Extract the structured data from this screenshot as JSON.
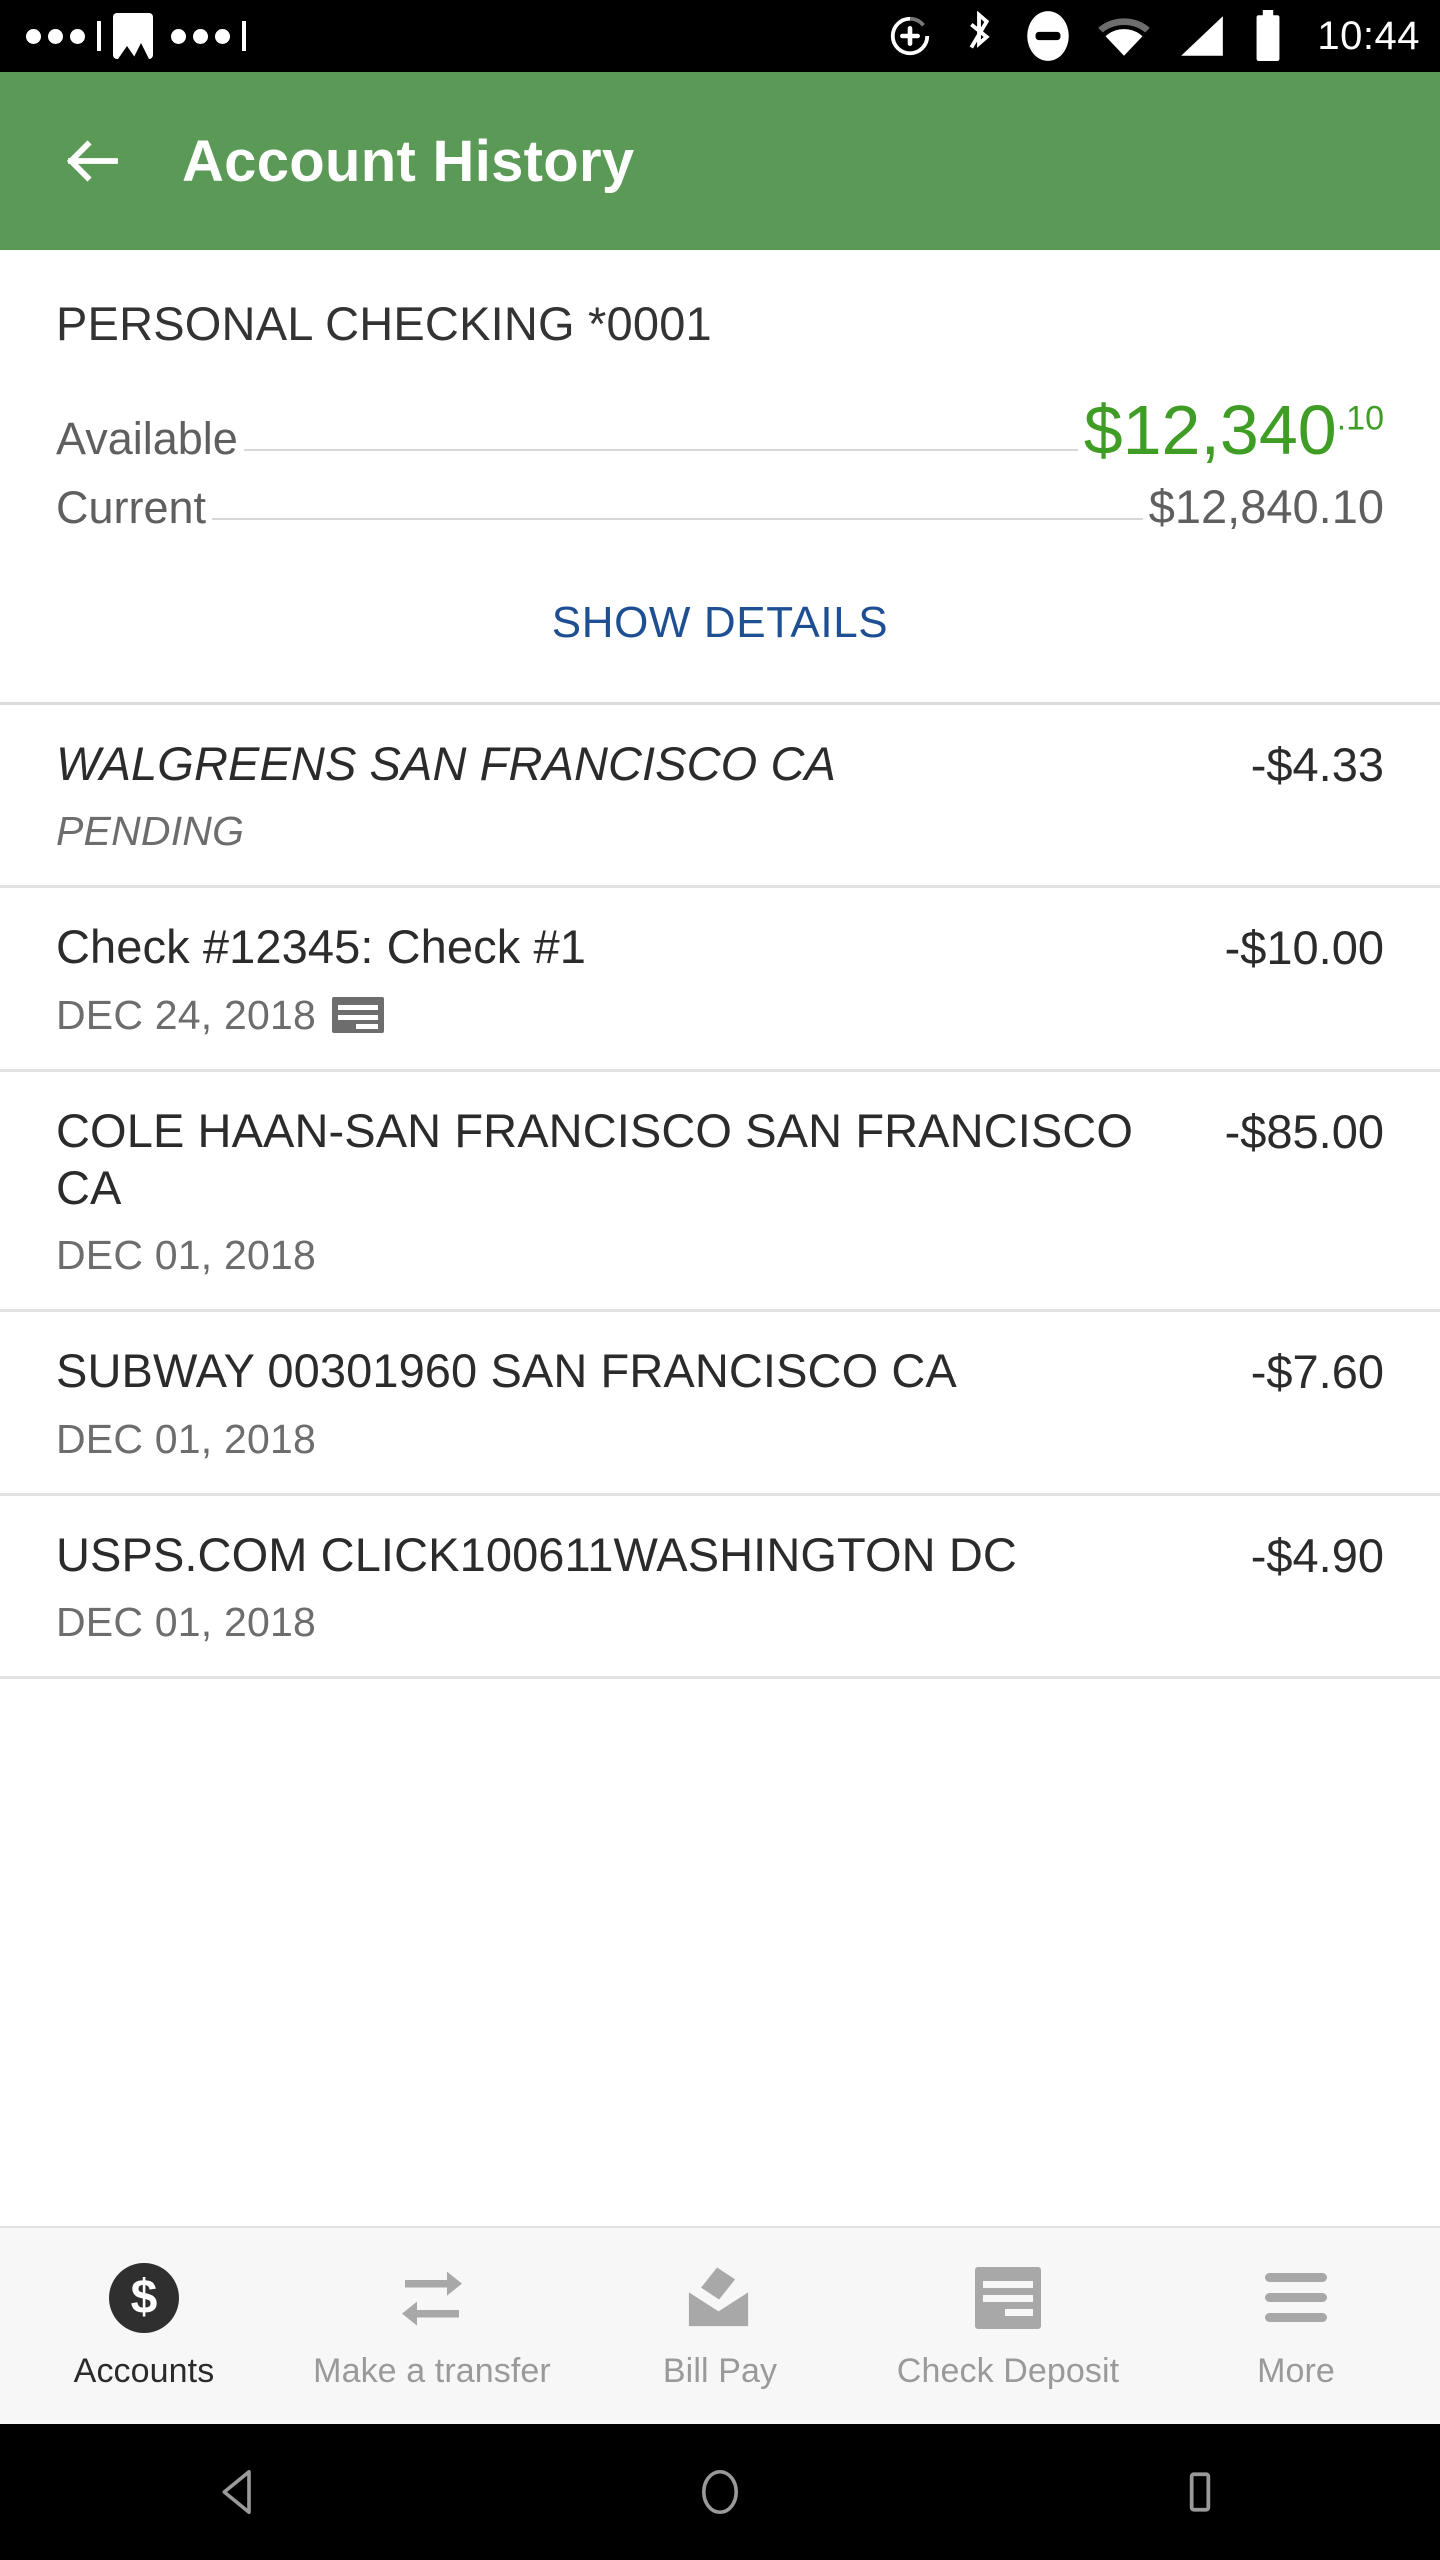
{
  "status_bar": {
    "time": "10:44",
    "left_icons": [
      "more-dots-icon",
      "image-icon",
      "more-dots-icon"
    ],
    "right_icons": [
      "sync-add-icon",
      "bluetooth-icon",
      "do-not-disturb-icon",
      "wifi-icon",
      "cellular-signal-icon",
      "battery-icon"
    ]
  },
  "app_bar": {
    "back_icon": "back-arrow-icon",
    "title": "Account History",
    "background_color": "#5a9a56"
  },
  "account_summary": {
    "account_name": "PERSONAL CHECKING *0001",
    "available_label": "Available",
    "available_amount_main": "$12,340",
    "available_amount_cents": ".10",
    "available_color": "#3f9c25",
    "current_label": "Current",
    "current_amount": "$12,840.10",
    "show_details_label": "SHOW DETAILS",
    "show_details_color": "#1f4f93"
  },
  "transactions": [
    {
      "description": "WALGREENS SAN FRANCISCO CA",
      "sub": "PENDING",
      "amount": "-$4.33",
      "pending": true,
      "has_check_image": false
    },
    {
      "description": "Check #12345: Check #1",
      "sub": "DEC 24, 2018",
      "amount": "-$10.00",
      "pending": false,
      "has_check_image": true
    },
    {
      "description": "COLE HAAN-SAN FRANCISCO SAN FRANCISCO CA",
      "sub": "DEC 01, 2018",
      "amount": "-$85.00",
      "pending": false,
      "has_check_image": false
    },
    {
      "description": "SUBWAY 00301960 SAN FRANCISCO CA",
      "sub": "DEC 01, 2018",
      "amount": "-$7.60",
      "pending": false,
      "has_check_image": false
    },
    {
      "description": "USPS.COM CLICK100611WASHINGTON DC",
      "sub": "DEC 01, 2018",
      "amount": "-$4.90",
      "pending": false,
      "has_check_image": false
    }
  ],
  "tab_bar": {
    "items": [
      {
        "label": "Accounts",
        "icon": "dollar-circle-icon",
        "active": true
      },
      {
        "label": "Make a transfer",
        "icon": "transfer-arrows-icon",
        "active": false
      },
      {
        "label": "Bill Pay",
        "icon": "envelope-icon",
        "active": false
      },
      {
        "label": "Check Deposit",
        "icon": "check-icon",
        "active": false
      },
      {
        "label": "More",
        "icon": "hamburger-icon",
        "active": false
      }
    ]
  },
  "android_nav": {
    "back": "nav-back-triangle-icon",
    "home": "nav-home-circle-icon",
    "recents": "nav-recents-square-icon"
  }
}
